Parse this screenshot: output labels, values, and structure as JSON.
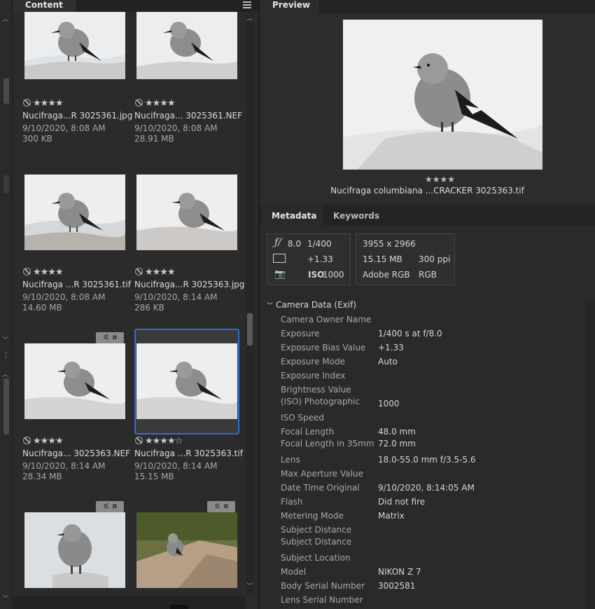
{
  "content_panel": {
    "tab_label": "Content",
    "items": [
      {
        "name": "Nucifraga...R 3025361.jpg",
        "date": "9/10/2020, 8:08 AM",
        "size": "300 KB",
        "rating": 4,
        "rating_text": "★★★★"
      },
      {
        "name": "Nucifraga... 3025361.NEF",
        "date": "9/10/2020, 8:08 AM",
        "size": "28.91 MB",
        "rating": 4,
        "rating_text": "★★★★"
      },
      {
        "name": "Nucifraga ...R 3025361.tif",
        "date": "9/10/2020, 8:08 AM",
        "size": "14.60 MB",
        "rating": 4,
        "rating_text": "★★★★"
      },
      {
        "name": "Nucifraga...R 3025363.jpg",
        "date": "9/10/2020, 8:14 AM",
        "size": "286 KB",
        "rating": 4,
        "rating_text": "★★★★"
      },
      {
        "name": "Nucifraga... 3025363.NEF",
        "date": "9/10/2020, 8:14 AM",
        "size": "28.34 MB",
        "rating": 4,
        "rating_text": "★★★★"
      },
      {
        "name": "Nucifraga ...R 3025363.tif",
        "date": "9/10/2020, 8:14 AM",
        "size": "15.15 MB",
        "rating": 4,
        "rating_text": "★★★★☆",
        "selected": true
      }
    ],
    "badge_icons": [
      "adjust-sliders-icon",
      "crop-icon"
    ]
  },
  "preview_panel": {
    "tab_label": "Preview",
    "rating_text": "★★★★",
    "caption": "Nucifraga columbiana ...CRACKER 3025363.tif"
  },
  "metadata_panel": {
    "tabs": [
      "Metadata",
      "Keywords"
    ],
    "summary": {
      "aperture": "8.0",
      "shutter": "1/400",
      "exposure_bias": "+1.33",
      "iso_label": "ISO",
      "iso": "1000",
      "dimensions": "3955 x 2966",
      "file_size": "15.15 MB",
      "resolution": "300 ppi",
      "color_profile": "Adobe RGB",
      "color_mode": "RGB"
    },
    "section_title": "Camera Data (Exif)",
    "rows": [
      {
        "label": "Camera Owner Name",
        "value": ""
      },
      {
        "label": "Exposure",
        "value": "1/400 s at f/8.0"
      },
      {
        "label": "Exposure Bias Value",
        "value": "+1.33"
      },
      {
        "label": "Exposure Mode",
        "value": "Auto"
      },
      {
        "label": "Exposure Index",
        "value": ""
      },
      {
        "label": "Brightness Value",
        "value": ""
      },
      {
        "label": "(ISO) Photographic",
        "value": "1000"
      },
      {
        "label": "ISO Speed",
        "value": ""
      },
      {
        "label": "Focal Length",
        "value": "48.0 mm"
      },
      {
        "label": "Focal Length in 35mm",
        "value": "72.0 mm"
      },
      {
        "label": "Lens",
        "value": "18.0-55.0 mm f/3.5-5.6"
      },
      {
        "label": "Max Aperture Value",
        "value": ""
      },
      {
        "label": "Date Time Original",
        "value": "9/10/2020, 8:14:05 AM"
      },
      {
        "label": "Flash",
        "value": "Did not fire"
      },
      {
        "label": "Metering Mode",
        "value": "Matrix"
      },
      {
        "label": "Subject Distance",
        "value": ""
      },
      {
        "label": "Subject Distance",
        "value": ""
      },
      {
        "label": "Subject Location",
        "value": ""
      },
      {
        "label": "Model",
        "value": "NIKON Z 7"
      },
      {
        "label": "Body Serial Number",
        "value": "3002581"
      },
      {
        "label": "Lens Serial Number",
        "value": ""
      }
    ]
  }
}
